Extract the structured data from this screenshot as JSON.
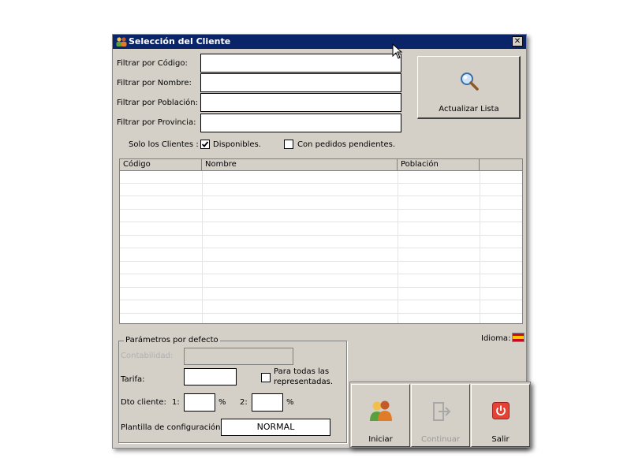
{
  "window": {
    "title": "Selección del Cliente",
    "close_glyph": "✕"
  },
  "filters": [
    {
      "label": "Filtrar por Código:",
      "value": ""
    },
    {
      "label": "Filtrar por Nombre:",
      "value": ""
    },
    {
      "label": "Filtrar por Población:",
      "value": ""
    },
    {
      "label": "Filtrar por Provincia:",
      "value": ""
    }
  ],
  "refresh_button": {
    "label": "Actualizar Lista",
    "icon": "magnifier-icon"
  },
  "only_clients": {
    "label": "Solo los Clientes :",
    "available": {
      "label": "Disponibles.",
      "checked": true
    },
    "pending": {
      "label": "Con pedidos pendientes.",
      "checked": false
    }
  },
  "grid": {
    "columns": [
      "Código",
      "Nombre",
      "Población",
      ""
    ],
    "rows": []
  },
  "language": {
    "label": "Idioma:",
    "flag": "spain-flag-icon"
  },
  "defaults": {
    "title": "Parámetros por defecto",
    "accounting_label": "Contabilidad:",
    "rate_label": "Tarifa:",
    "rate_value": "",
    "all_reps_label_line1": "Para todas las",
    "all_reps_label_line2": "representadas.",
    "all_reps_checked": false,
    "discount_label": "Dto cliente:",
    "discount1_label": "1:",
    "discount1_value": "",
    "discount2_label": "2:",
    "discount2_value": "",
    "percent": "%",
    "template_label": "Plantilla de configuración:",
    "template_value": "NORMAL"
  },
  "actions": {
    "start": {
      "label": "Iniciar",
      "icon": "users-icon"
    },
    "continue": {
      "label": "Continuar",
      "icon": "continue-arrow-icon",
      "enabled": false
    },
    "exit": {
      "label": "Salir",
      "icon": "power-icon"
    }
  }
}
